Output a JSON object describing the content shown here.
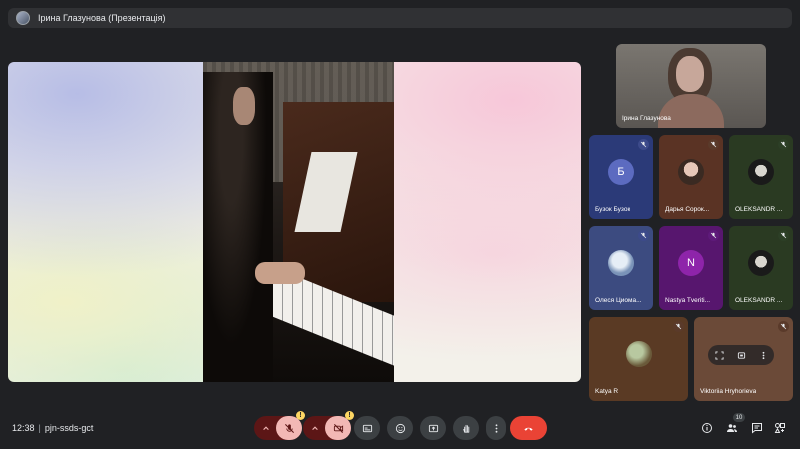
{
  "top": {
    "title": "Ірина Глазунова (Презентація)"
  },
  "self_tile": {
    "name": "Ірина Глазунова"
  },
  "participants": [
    {
      "name": "Бузок Бузок",
      "initial": "Б",
      "avatar_color": "#5c6bc0",
      "bg": "#2b3a78"
    },
    {
      "name": "Дарья Сорок...",
      "bg": "#5a3324"
    },
    {
      "name": "OLEKSANDR ...",
      "bg": "#2a3a22"
    },
    {
      "name": "Олеся Циома...",
      "bg": "#3c4b80"
    },
    {
      "name": "Nastya Tveriti...",
      "initial": "N",
      "avatar_color": "#8e24aa",
      "bg": "#57166e"
    },
    {
      "name": "OLEKSANDR ...",
      "bg": "#2a3a22"
    },
    {
      "name": "Katya R",
      "bg": "#5a3a24"
    },
    {
      "name": "Viktoriia Hryhorieva",
      "bg": "#6b4a38"
    }
  ],
  "meeting": {
    "time": "12:38",
    "separator": "|",
    "code": "pjn-ssds-gct"
  },
  "people_count": "10",
  "warn_glyph": "!",
  "colors": {
    "background": "#202124",
    "end_call": "#ea4335",
    "muted_fill": "#f2b8b5",
    "muted_pair": "#5c1616"
  }
}
